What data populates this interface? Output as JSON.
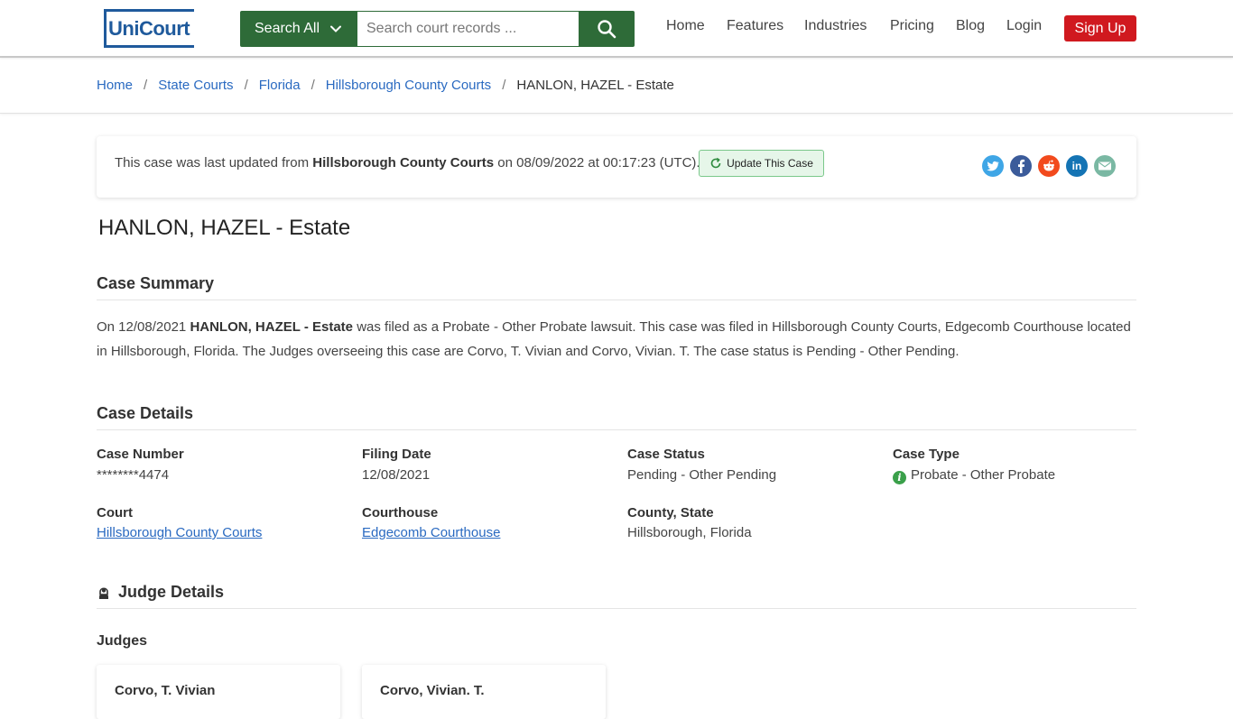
{
  "header": {
    "logo_text": "UniCourt",
    "search_dropdown_label": "Search All",
    "search_placeholder": "Search court records ...",
    "nav": [
      "Home",
      "Features",
      "Industries",
      "Pricing",
      "Blog",
      "Login"
    ],
    "signup_label": "Sign Up"
  },
  "breadcrumb": {
    "items": [
      "Home",
      "State Courts",
      "Florida",
      "Hillsborough County Courts"
    ],
    "separator": "/",
    "current": "HANLON, HAZEL - Estate"
  },
  "update": {
    "prefix": "This case was last updated from",
    "court": "Hillsborough County Courts",
    "suffix": "on 08/09/2022 at 00:17:23 (UTC).",
    "button_label": "Update This Case",
    "share_icons": [
      "twitter-icon",
      "facebook-icon",
      "reddit-icon",
      "linkedin-icon",
      "email-icon"
    ]
  },
  "case": {
    "title": "HANLON, HAZEL - Estate"
  },
  "summary": {
    "heading": "Case Summary",
    "text_before": "On 12/08/2021",
    "bold_name": "HANLON, HAZEL - Estate",
    "text_after": "was filed as a Probate - Other Probate lawsuit. This case was filed in Hillsborough County Courts, Edgecomb Courthouse located in Hillsborough, Florida. The Judges overseeing this case are Corvo, T. Vivian and Corvo, Vivian. T. The case status is Pending - Other Pending."
  },
  "details": {
    "heading": "Case Details",
    "case_number_label": "Case Number",
    "case_number": "********4474",
    "filing_date_label": "Filing Date",
    "filing_date": "12/08/2021",
    "case_status_label": "Case Status",
    "case_status": "Pending - Other Pending",
    "case_type_label": "Case Type",
    "case_type": "Probate - Other Probate",
    "court_label": "Court",
    "court": "Hillsborough County Courts",
    "courthouse_label": "Courthouse",
    "courthouse": "Edgecomb Courthouse",
    "county_state_label": "County, State",
    "county_state": "Hillsborough, Florida"
  },
  "judges": {
    "heading": "Judge Details",
    "subheading": "Judges",
    "list": [
      "Corvo, T. Vivian",
      "Corvo, Vivian. T."
    ]
  },
  "colors": {
    "brand_blue": "#1f5a9c",
    "search_green": "#2e6b38",
    "signup_red": "#d0191f",
    "link_blue": "#2a6ac1"
  }
}
